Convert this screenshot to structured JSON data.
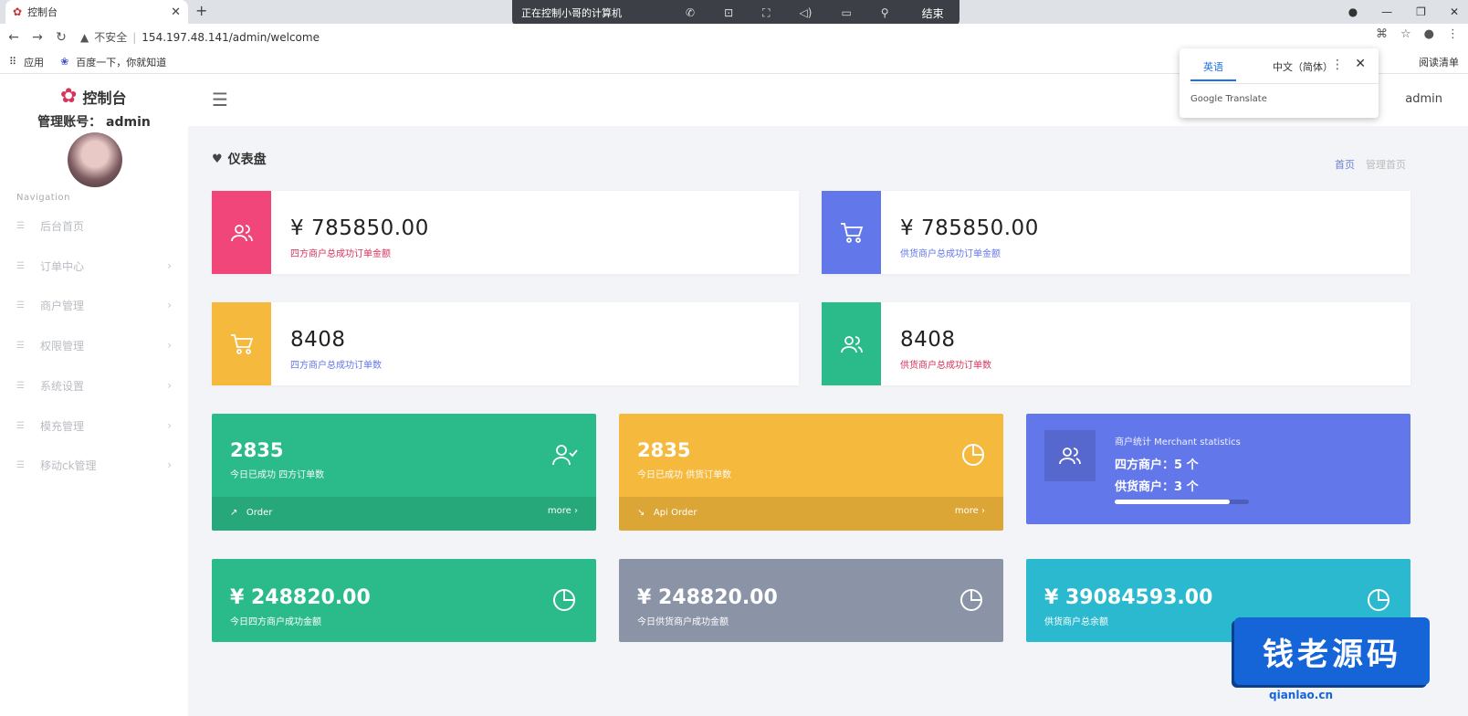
{
  "browser": {
    "tab_title": "控制台",
    "new_tab": "+",
    "address": "154.197.48.141/admin/welcome",
    "insecure_label": "不安全",
    "bookmarks": [
      "应用",
      "百度一下，你就知道"
    ],
    "bookmarks_right": "阅读清单"
  },
  "remote_bar": {
    "title": "正在控制小哥的计算机",
    "end": "结束"
  },
  "translate_popup": {
    "tab_en": "英语",
    "tab_zh": "中文（简体）",
    "brand": "Google Translate"
  },
  "sidebar": {
    "logo": "控制台",
    "account": "管理账号： admin",
    "nav_label": "Navigation",
    "items": [
      {
        "label": "后台首页",
        "chevron": false
      },
      {
        "label": "订单中心",
        "chevron": true
      },
      {
        "label": "商户管理",
        "chevron": true
      },
      {
        "label": "权限管理",
        "chevron": true
      },
      {
        "label": "系统设置",
        "chevron": true
      },
      {
        "label": "模充管理",
        "chevron": true
      },
      {
        "label": "移动ck管理",
        "chevron": true
      }
    ]
  },
  "header": {
    "user": "admin"
  },
  "page": {
    "title": "仪表盘",
    "breadcrumb": [
      "首页",
      "管理首页"
    ]
  },
  "stat_cards": [
    {
      "value": "¥ 785850.00",
      "label": "四方商户总成功订单金额",
      "color": "#f0467a",
      "icon": "users-icon",
      "label_color": "#d8335b"
    },
    {
      "value": "¥ 785850.00",
      "label": "供货商户总成功订单金额",
      "color": "#6277ea",
      "icon": "cart-icon",
      "label_color": "#6277ea"
    },
    {
      "value": "8408",
      "label": "四方商户总成功订单数",
      "color": "#f5b93d",
      "icon": "cart-icon",
      "label_color": "#6277ea"
    },
    {
      "value": "8408",
      "label": "供货商户总成功订单数",
      "color": "#2bbb8a",
      "icon": "users-icon",
      "label_color": "#d8335b"
    }
  ],
  "mid_cards": [
    {
      "num": "2835",
      "sub": "今日已成功 四方订单数",
      "foot": "Order",
      "more": "more ›",
      "color": "#2bbb8a",
      "icon": "user-check-icon"
    },
    {
      "num": "2835",
      "sub": "今日已成功 供货订单数",
      "foot": "Api Order",
      "more": "more ›",
      "color": "#f5b93d",
      "icon": "pie-chart-icon"
    }
  ],
  "merchant_stats": {
    "title": "商户统计 Merchant statistics",
    "line1": "四方商户：5 个",
    "line2": "供货商户：3 个",
    "progress": 0.86,
    "color": "#6277ea"
  },
  "bottom_cards": [
    {
      "num": "¥ 248820.00",
      "sub": "今日四方商户成功金额",
      "color": "#2bbb8a",
      "icon": "pie-chart-icon"
    },
    {
      "num": "¥ 248820.00",
      "sub": "今日供货商户成功金额",
      "color": "#8b93a6",
      "icon": "pie-chart-icon"
    },
    {
      "num": "¥ 39084593.00",
      "sub": "供货商户总余额",
      "color": "#2ab9cf",
      "icon": "pie-chart-icon"
    }
  ],
  "watermark": {
    "text": "钱老源码",
    "url": "qianlao.cn"
  }
}
